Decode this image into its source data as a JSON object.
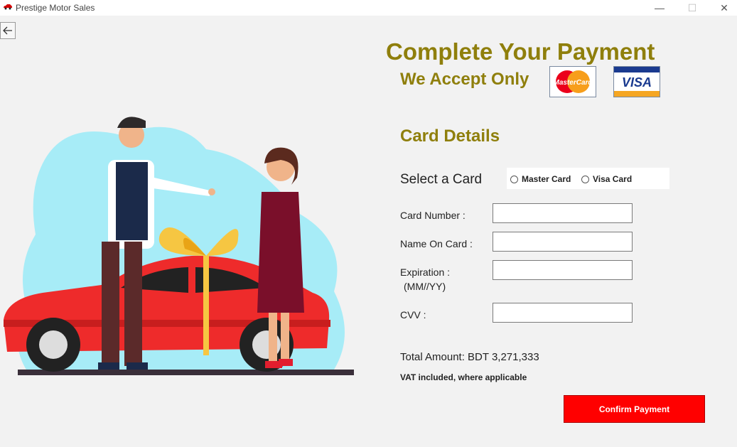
{
  "window": {
    "title": "Prestige Motor Sales",
    "minimize_glyph": "—",
    "maximize_glyph": "☐",
    "close_glyph": "✕"
  },
  "nav": {
    "back_icon": "arrow-left-icon"
  },
  "payment": {
    "heading": "Complete Your Payment",
    "accept_text": "We Accept Only",
    "mastercard_logo_text": "MasterCard",
    "visa_logo_text": "VISA",
    "section_title": "Card Details",
    "select_card_label": "Select a Card",
    "card_options": [
      "Master Card",
      "Visa Card"
    ],
    "fields": {
      "card_number_label": "Card Number :",
      "name_on_card_label": "Name On Card :",
      "expiration_label": "Expiration :",
      "expiration_format": "(MM//YY)",
      "cvv_label": "CVV :"
    },
    "total_amount": "Total Amount: BDT 3,271,333",
    "vat_note": "VAT included, where applicable",
    "confirm_label": "Confirm Payment"
  },
  "colors": {
    "heading": "#8f7f0c",
    "confirm_button": "#ff0000",
    "background": "#f2f2f2"
  }
}
